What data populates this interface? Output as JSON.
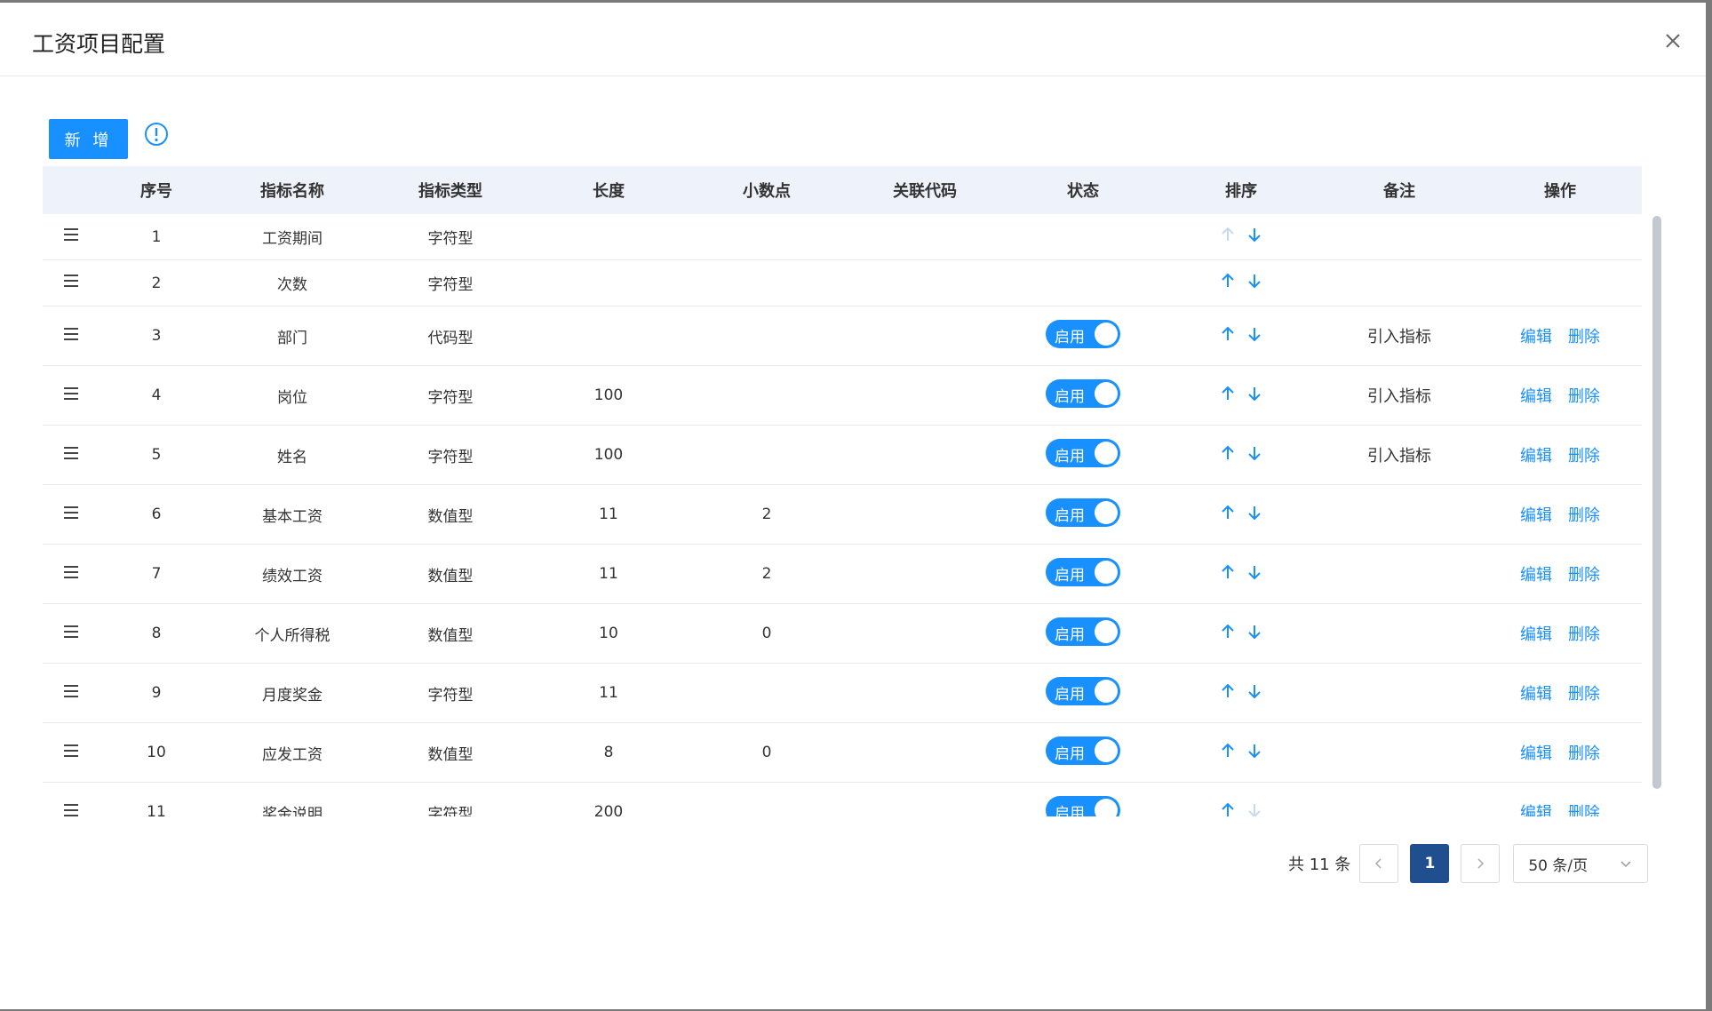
{
  "dialog": {
    "title": "工资项目配置"
  },
  "toolbar": {
    "add_label": "新 增"
  },
  "columns": [
    "序号",
    "指标名称",
    "指标类型",
    "长度",
    "小数点",
    "关联代码",
    "状态",
    "排序",
    "备注",
    "操作"
  ],
  "rows": [
    {
      "index": "1",
      "name": "工资期间",
      "type": "字符型",
      "length": "",
      "decimal": "",
      "code": "",
      "status": "",
      "remark": "",
      "has_actions": false,
      "up_enabled": false,
      "down_enabled": true
    },
    {
      "index": "2",
      "name": "次数",
      "type": "字符型",
      "length": "",
      "decimal": "",
      "code": "",
      "status": "",
      "remark": "",
      "has_actions": false,
      "up_enabled": true,
      "down_enabled": true
    },
    {
      "index": "3",
      "name": "部门",
      "type": "代码型",
      "length": "",
      "decimal": "",
      "code": "",
      "status": "启用",
      "remark": "引入指标",
      "has_actions": true,
      "up_enabled": true,
      "down_enabled": true
    },
    {
      "index": "4",
      "name": "岗位",
      "type": "字符型",
      "length": "100",
      "decimal": "",
      "code": "",
      "status": "启用",
      "remark": "引入指标",
      "has_actions": true,
      "up_enabled": true,
      "down_enabled": true
    },
    {
      "index": "5",
      "name": "姓名",
      "type": "字符型",
      "length": "100",
      "decimal": "",
      "code": "",
      "status": "启用",
      "remark": "引入指标",
      "has_actions": true,
      "up_enabled": true,
      "down_enabled": true
    },
    {
      "index": "6",
      "name": "基本工资",
      "type": "数值型",
      "length": "11",
      "decimal": "2",
      "code": "",
      "status": "启用",
      "remark": "",
      "has_actions": true,
      "up_enabled": true,
      "down_enabled": true
    },
    {
      "index": "7",
      "name": "绩效工资",
      "type": "数值型",
      "length": "11",
      "decimal": "2",
      "code": "",
      "status": "启用",
      "remark": "",
      "has_actions": true,
      "up_enabled": true,
      "down_enabled": true
    },
    {
      "index": "8",
      "name": "个人所得税",
      "type": "数值型",
      "length": "10",
      "decimal": "0",
      "code": "",
      "status": "启用",
      "remark": "",
      "has_actions": true,
      "up_enabled": true,
      "down_enabled": true
    },
    {
      "index": "9",
      "name": "月度奖金",
      "type": "字符型",
      "length": "11",
      "decimal": "",
      "code": "",
      "status": "启用",
      "remark": "",
      "has_actions": true,
      "up_enabled": true,
      "down_enabled": true
    },
    {
      "index": "10",
      "name": "应发工资",
      "type": "数值型",
      "length": "8",
      "decimal": "0",
      "code": "",
      "status": "启用",
      "remark": "",
      "has_actions": true,
      "up_enabled": true,
      "down_enabled": true
    },
    {
      "index": "11",
      "name": "奖金说明",
      "type": "字符型",
      "length": "200",
      "decimal": "",
      "code": "",
      "status": "启用",
      "remark": "",
      "has_actions": true,
      "up_enabled": true,
      "down_enabled": false
    }
  ],
  "actions": {
    "edit": "编辑",
    "delete": "删除"
  },
  "pagination": {
    "total": "共 11 条",
    "current": "1",
    "page_size": "50 条/页"
  },
  "colors": {
    "primary": "#1890ff",
    "header_bg": "#eef2fa",
    "active_page": "#1f4f8f"
  }
}
